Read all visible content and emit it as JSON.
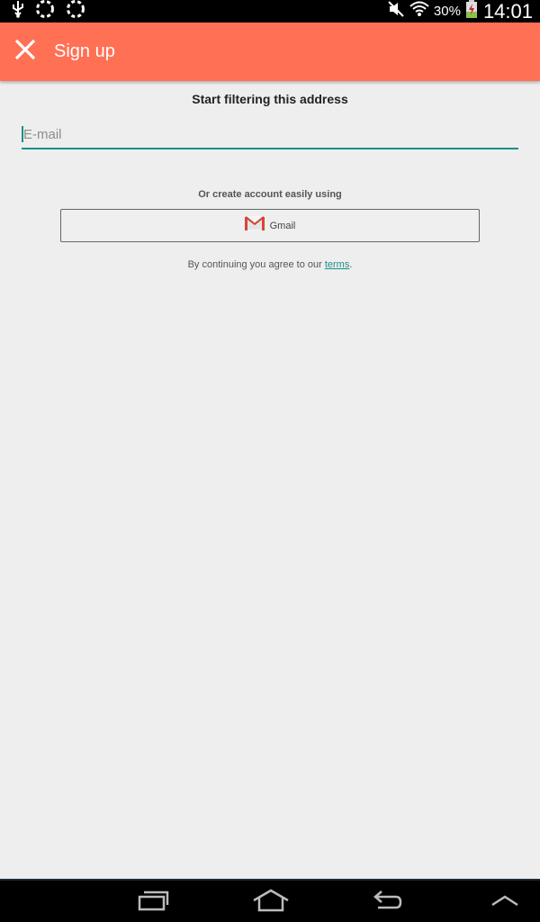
{
  "status_bar": {
    "battery_pct": "30%",
    "time": "14:01",
    "icons": [
      "usb-icon",
      "sync-icon",
      "sync-icon",
      "mute-icon",
      "wifi-icon",
      "battery-icon"
    ]
  },
  "app_bar": {
    "title": "Sign up",
    "close_icon": "close-icon",
    "color": "#ff7055"
  },
  "form": {
    "heading": "Start filtering this address",
    "email_placeholder": "E-mail",
    "email_value": "",
    "or_label": "Or create account easily using",
    "gmail_label": "Gmail",
    "terms_prefix": "By continuing you agree to our ",
    "terms_link": "terms",
    "terms_suffix": ".",
    "accent_color": "#1a8f8a"
  },
  "nav_bar": {
    "icons": [
      "recent-apps-icon",
      "home-icon",
      "back-icon",
      "menu-up-icon"
    ]
  }
}
